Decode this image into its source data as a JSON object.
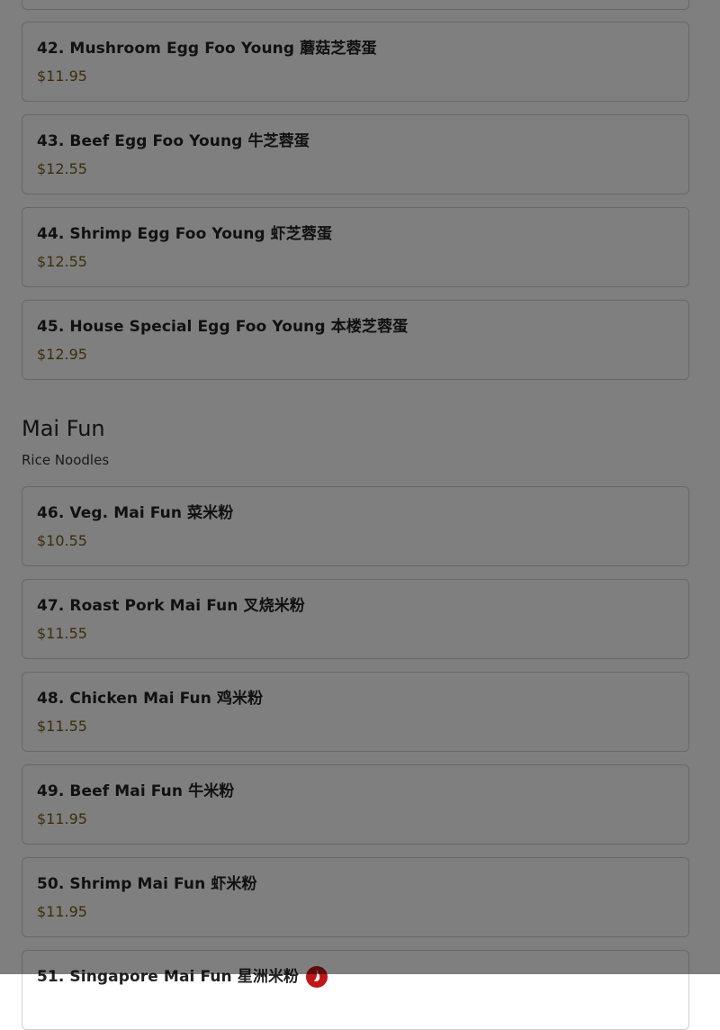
{
  "egg_foo_young_items": [
    {
      "name": "42. Mushroom Egg Foo Young 蘑菇芝蓉蛋",
      "price": "$11.95"
    },
    {
      "name": "43. Beef Egg Foo Young 牛芝蓉蛋",
      "price": "$12.55"
    },
    {
      "name": "44. Shrimp Egg Foo Young 虾芝蓉蛋",
      "price": "$12.55"
    },
    {
      "name": "45. House Special Egg Foo Young 本楼芝蓉蛋",
      "price": "$12.95"
    }
  ],
  "mai_fun": {
    "title": "Mai Fun",
    "description": "Rice Noodles",
    "items": [
      {
        "name": "46. Veg. Mai Fun 菜米粉",
        "price": "$10.55"
      },
      {
        "name": "47. Roast Pork Mai Fun 叉烧米粉",
        "price": "$11.55"
      },
      {
        "name": "48. Chicken Mai Fun 鸡米粉",
        "price": "$11.55"
      },
      {
        "name": "49. Beef Mai Fun 牛米粉",
        "price": "$11.95"
      },
      {
        "name": "50. Shrimp Mai Fun 虾米粉",
        "price": "$11.95"
      },
      {
        "name": "51. Singapore Mai Fun 星洲米粉",
        "price": "",
        "icon": "spicy-pepper-icon"
      }
    ]
  },
  "colors": {
    "price": "#7a5a16",
    "spicy_badge": "#c01818",
    "overlay": "rgba(0,0,0,0.5)"
  }
}
